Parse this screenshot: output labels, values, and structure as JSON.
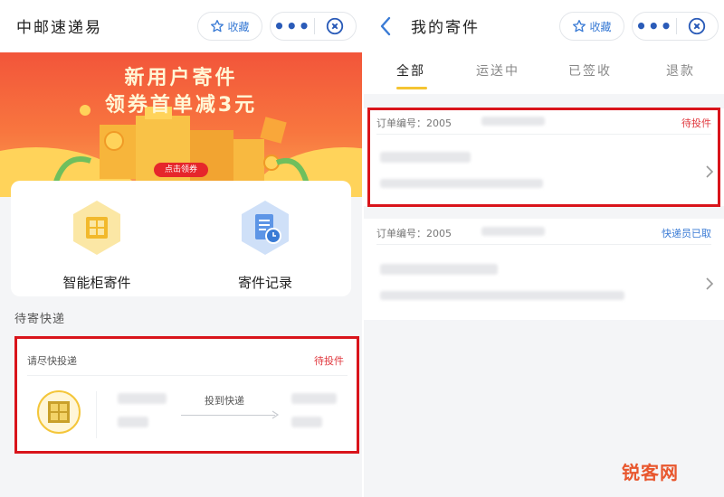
{
  "left": {
    "title": "中邮速递易",
    "favorite_label": "收藏",
    "more_label": "•••",
    "banner": {
      "headline_line1": "新用户寄件",
      "headline_line2": "领券首单减3元",
      "button_label": "点击领券"
    },
    "services": [
      {
        "label": "智能柜寄件",
        "icon": "locker-icon"
      },
      {
        "label": "寄件记录",
        "icon": "document-clock-icon"
      }
    ],
    "pending_section_title": "待寄快递",
    "pending_card": {
      "header": "请尽快投递",
      "status": "待投件",
      "middle_label": "投到快递"
    }
  },
  "right": {
    "title": "我的寄件",
    "favorite_label": "收藏",
    "more_label": "•••",
    "tabs": [
      {
        "label": "全部",
        "active": true
      },
      {
        "label": "运送中",
        "active": false
      },
      {
        "label": "已签收",
        "active": false
      },
      {
        "label": "退款",
        "active": false
      }
    ],
    "orders": [
      {
        "id_prefix": "订单编号：2005",
        "status": "待投件",
        "status_type": "red"
      },
      {
        "id_prefix": "订单编号：2005",
        "status": "快递员已取",
        "status_type": "blue"
      }
    ]
  },
  "watermark": "锐客网",
  "colors": {
    "accent_blue": "#3a7bd5",
    "status_red": "#e0383e",
    "highlight_box": "#d9141b",
    "tab_underline": "#f5c432",
    "banner_orange": "#f8763f"
  }
}
